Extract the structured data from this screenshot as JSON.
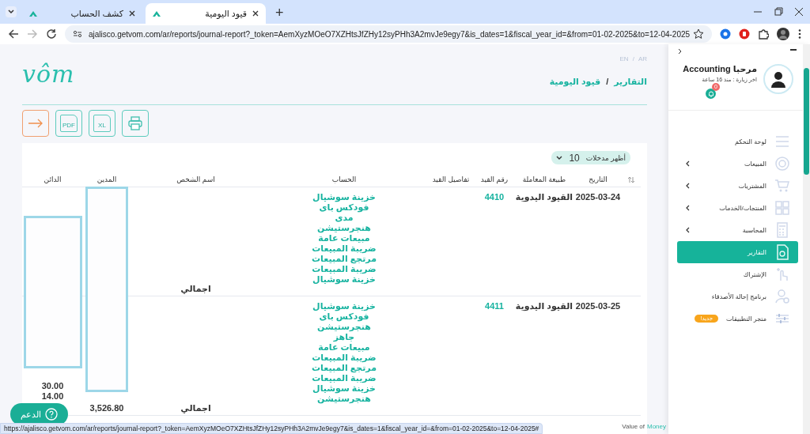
{
  "browser": {
    "tabs": [
      {
        "title": "قيود اليومية",
        "selected": true
      },
      {
        "title": "كشف الحساب",
        "selected": false
      }
    ],
    "new_tab": "+",
    "url": "ajalisco.getvom.com/ar/reports/journal-report?_token=AemXyzMOeO7XZHtsJfZHy12syPHh3A2mvJe9egy7&is_dates=1&fiscal_year_id=&from=01-02-2025&to=12-04-2025",
    "forward_disabled": true
  },
  "header": {
    "logo": "vôm",
    "languages": [
      "AR",
      "EN"
    ],
    "language_separator": "/",
    "breadcrumb": [
      "التقارير",
      "قيود اليومية"
    ],
    "breadcrumb_separator": "/"
  },
  "actions": [
    {
      "kind": "print"
    },
    {
      "kind": "excel",
      "label": "XL"
    },
    {
      "kind": "pdf",
      "label": "PDF"
    },
    {
      "kind": "back"
    }
  ],
  "page_size": {
    "label": "أظهر مدخلات",
    "value": "10"
  },
  "table": {
    "columns": [
      "التاريخ",
      "طبيعة المعاملة",
      "رقم القيد",
      "تفاصيل القيد",
      "الحساب",
      "اسم الشخص",
      "المدين",
      "الدائن"
    ],
    "rows": [
      {
        "date": "2025-03-24",
        "type": "القيود اليدوية",
        "number": "4410",
        "accounts": [
          "خزينة سوشيال",
          "فودكس باى",
          "مدى",
          "هنجرستيشن",
          "مبيعات عامة",
          "ضريبة المبيعات",
          "مرتجع المبيعات",
          "ضريبة المبيعات",
          "خزينة سوشيال"
        ],
        "total_label": "اجمالي",
        "debit": [],
        "credit": []
      },
      {
        "date": "2025-03-25",
        "type": "القيود اليدوية",
        "number": "4411",
        "accounts": [
          "خزينة سوشيال",
          "فودكس باى",
          "هنجرستيشن",
          "جاهز",
          "مبيعات عامة",
          "ضريبة المبيعات",
          "مرتجع المبيعات",
          "ضريبة المبيعات",
          "خزينة سوشيال",
          "هنجرستيشن"
        ],
        "total_label": "اجمالي",
        "debit": [
          "3,526.80"
        ],
        "credit": [
          "30.00",
          "14.00"
        ]
      }
    ]
  },
  "support": {
    "label": "الدعم"
  },
  "footer": {
    "text": "Value of",
    "brand": "Money"
  },
  "status_bar": {
    "url": "https://ajalisco.getvom.com/ar/reports/journal-report?_token=AemXyzMOeO7XZHtsJfZHy12syPHh3A2mvJe9egy7&is_dates=1&fiscal_year_id=&from=01-02-2025&to=12-04-2025#"
  },
  "sidebar": {
    "greeting": "مرحبا Accounting",
    "last_visit": "اخر زيارة : منذ 16 ساعة",
    "notifications": "0",
    "items": [
      {
        "label": "لوحة التحكم",
        "has_children": false,
        "selected": false
      },
      {
        "label": "المبيعات",
        "has_children": true,
        "selected": false
      },
      {
        "label": "المشتريات",
        "has_children": true,
        "selected": false
      },
      {
        "label": "المنتجات/الخدمات",
        "has_children": true,
        "selected": false
      },
      {
        "label": "المحاسبة",
        "has_children": true,
        "selected": false
      },
      {
        "label": "التقارير",
        "has_children": false,
        "selected": true
      },
      {
        "label": "الإشتراك",
        "has_children": false,
        "selected": false
      },
      {
        "label": "برنامج إحالة الأصدقاء",
        "has_children": false,
        "selected": false
      },
      {
        "label": "متجر التطبيقات",
        "has_children": false,
        "selected": false,
        "badge": "جديد!"
      }
    ]
  }
}
